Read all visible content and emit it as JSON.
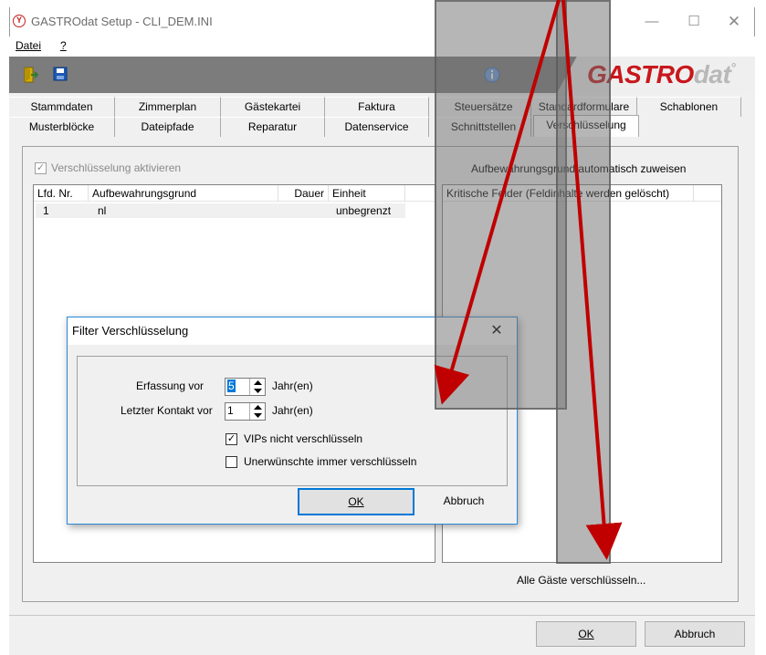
{
  "window": {
    "title": "GASTROdat Setup - CLI_DEM.INI",
    "icon_glyph": "Y",
    "minimize_glyph": "—",
    "maximize_glyph": "☐",
    "close_glyph": "✕"
  },
  "menu": {
    "datei": "Datei",
    "help": "?"
  },
  "toolbar": {
    "exit_icon": "exit-icon",
    "save_icon": "save-icon",
    "info_icon": "info-icon"
  },
  "logo": {
    "main": "GASTRO",
    "suffix": "dat",
    "reg": "°"
  },
  "tabs_row1": [
    "Stammdaten",
    "Zimmerplan",
    "Gästekartei",
    "Faktura",
    "Steuersätze",
    "Standardformulare",
    "Schablonen"
  ],
  "tabs_row2": [
    "Musterblöcke",
    "Dateipfade",
    "Reparatur",
    "Datenservice",
    "Schnittstellen",
    "Verschlüsselung"
  ],
  "active_tab": "Verschlüsselung",
  "panel": {
    "enable_checkbox_label": "Verschlüsselung aktivieren",
    "enable_checked": true,
    "assign_label": "Aufbewahrungsgrund automatisch zuweisen",
    "left_table": {
      "columns": [
        "Lfd. Nr.",
        "Aufbewahrungsgrund",
        "Dauer",
        "Einheit"
      ],
      "rows": [
        [
          "1",
          "nl",
          "",
          "unbegrenzt"
        ]
      ]
    },
    "right_table": {
      "columns": [
        "Kritische Felder (Feldinhalte werden gelöscht)"
      ]
    },
    "encrypt_all_label": "Alle Gäste verschlüsseln..."
  },
  "footer": {
    "ok": "OK",
    "cancel": "Abbruch"
  },
  "dialog": {
    "title": "Filter Verschlüsselung",
    "close_glyph": "✕",
    "erfassung_label": "Erfassung vor",
    "erfassung_value": "5",
    "erfassung_unit": "Jahr(en)",
    "kontakt_label": "Letzter Kontakt vor",
    "kontakt_value": "1",
    "kontakt_unit": "Jahr(en)",
    "vip_label": "VIPs nicht verschlüsseln",
    "vip_checked": true,
    "unwanted_label": "Unerwünschte immer verschlüsseln",
    "unwanted_checked": false,
    "ok": "OK",
    "cancel": "Abbruch"
  },
  "colors": {
    "accent": "#0078d7",
    "brand_red": "#c8171c",
    "arrow_red": "#c00000",
    "toolbar_gray": "#7c7c7c"
  }
}
